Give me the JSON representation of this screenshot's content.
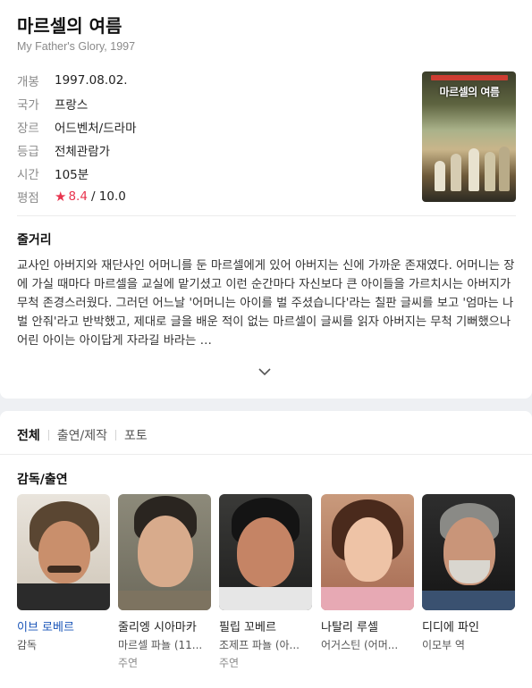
{
  "movie": {
    "title": "마르셀의 여름",
    "subtitle": "My Father's Glory, 1997"
  },
  "info": [
    {
      "label": "개봉",
      "value": "1997.08.02."
    },
    {
      "label": "국가",
      "value": "프랑스"
    },
    {
      "label": "장르",
      "value": "어드벤처/드라마"
    },
    {
      "label": "등급",
      "value": "전체관람가"
    },
    {
      "label": "시간",
      "value": "105분"
    }
  ],
  "rating": {
    "label": "평점",
    "score": "8.4",
    "max": "/ 10.0",
    "icon": "star-icon"
  },
  "poster": {
    "title": "마르셀의 여름"
  },
  "synopsis": {
    "heading": "줄거리",
    "text": "교사인 아버지와 재단사인 어머니를 둔 마르셀에게 있어 아버지는 신에 가까운 존재였다. 어머니는 장에 가실 때마다 마르셀을 교실에 맡기셨고 이런 순간마다 자신보다 큰 아이들을 가르치시는 아버지가 무척 존경스러웠다. 그러던 어느날 '어머니는 아이를 벌 주셨습니다'라는 칠판 글씨를 보고 '엄마는 나 벌 안줘'라고 반박했고, 제대로 글을 배운 적이 없는 마르셀이 글씨를 읽자 아버지는 무척 기뻐했으나 어린 아이는 아이답게 자라길 바라는 …",
    "expand_icon": "chevron-down-icon"
  },
  "tabs": [
    {
      "label": "전체",
      "active": true
    },
    {
      "label": "출연/제작",
      "active": false
    },
    {
      "label": "포토",
      "active": false
    }
  ],
  "cast_heading": "감독/출연",
  "cast": [
    {
      "name": "이브 로베르",
      "role": "감독",
      "type": ""
    },
    {
      "name": "줄리엥 시아마카",
      "role": "마르셀 파뇰 (11...",
      "type": "주연"
    },
    {
      "name": "필립 꼬베르",
      "role": "조제프 파뇰 (아...",
      "type": "주연"
    },
    {
      "name": "나탈리 루셀",
      "role": "어거스틴 (어머...",
      "type": ""
    },
    {
      "name": "디디에 파인",
      "role": "이모부 역",
      "type": ""
    }
  ],
  "colors": {
    "accent_red": "#e8344e",
    "link_blue": "#1a55b8"
  }
}
